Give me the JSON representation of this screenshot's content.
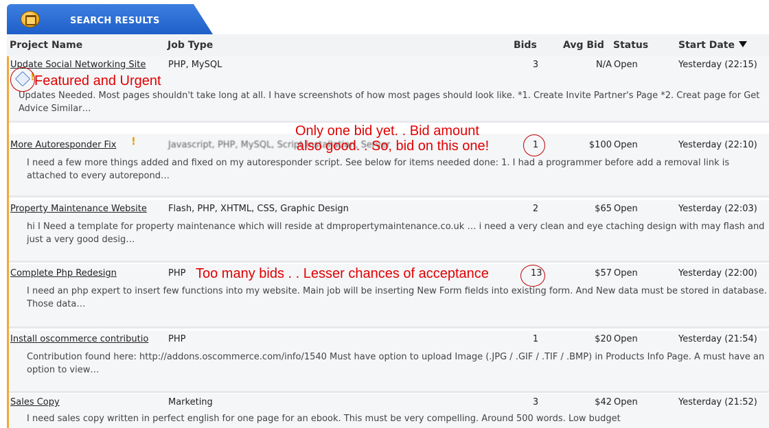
{
  "header": {
    "title": "SEARCH RESULTS",
    "icon": "folder-icon"
  },
  "columns": {
    "project": "Project Name",
    "type": "Job Type",
    "bids": "Bids",
    "avg": "Avg Bid",
    "status": "Status",
    "date": "Start Date"
  },
  "rows": [
    {
      "name": "Update Social Networking Site",
      "type": "PHP, MySQL",
      "bids": "3",
      "avg": "N/A",
      "status": "Open",
      "date": "Yesterday (22:15)",
      "description": "Updates Needed. Most pages shouldn't take long at all. I have screenshots of how most pages should look like. *1. Create Invite Partner's Page *2. Creat page for Get Advice Similar…"
    },
    {
      "name": "More Autoresponder Fix",
      "type": "Javascript, PHP, MySQL, Script Installation, Server",
      "bids": "1",
      "avg": "$100",
      "status": "Open",
      "date": "Yesterday (22:10)",
      "description": "I need a few more things added and fixed on my autoresponder script. See below for items needed done: 1. I had a programmer before add a removal link is attached to every autorepond…"
    },
    {
      "name": "Property Maintenance Website",
      "type": "Flash, PHP, XHTML, CSS, Graphic Design",
      "bids": "2",
      "avg": "$65",
      "status": "Open",
      "date": "Yesterday (22:03)",
      "description": "hi I Need a template for property maintenance which will reside at dmpropertymaintenance.co.uk … i need a very clean and eye ctaching design with may flash and just a very good desig…"
    },
    {
      "name": "Complete Php Redesign",
      "type": "PHP",
      "bids": "13",
      "avg": "$57",
      "status": "Open",
      "date": "Yesterday (22:00)",
      "description": "I need an php expert to insert few functions into my website. Main job will be inserting New Form fields into existing form. And New data must be stored in database. Those data…"
    },
    {
      "name": "Install oscommerce contributio",
      "type": "PHP",
      "bids": "1",
      "avg": "$20",
      "status": "Open",
      "date": "Yesterday (21:54)",
      "description": "Contribution found here: http://addons.oscommerce.com/info/1540 Must have option to upload Image (.JPG / .GIF / .TIF / .BMP) in Products Info Page. A must have an option to view…"
    },
    {
      "name": "Sales Copy",
      "type": "Marketing",
      "bids": "3",
      "avg": "$42",
      "status": "Open",
      "date": "Yesterday (21:52)",
      "description": "I need sales copy written in perfect english for one page for an ebook. This must be very compelling. Around 500 words. Low budget"
    }
  ],
  "annotations": {
    "featured": "Featured and Urgent",
    "one_bid_line1": "Only one bid yet. . Bid amount",
    "one_bid_line2": "also good. . So, bid on this one!",
    "too_many": "Too many bids . . Lesser chances of acceptance"
  },
  "colors": {
    "tab": "#2a6fd6",
    "accent": "#f3a73a",
    "annotation": "#e00000"
  }
}
